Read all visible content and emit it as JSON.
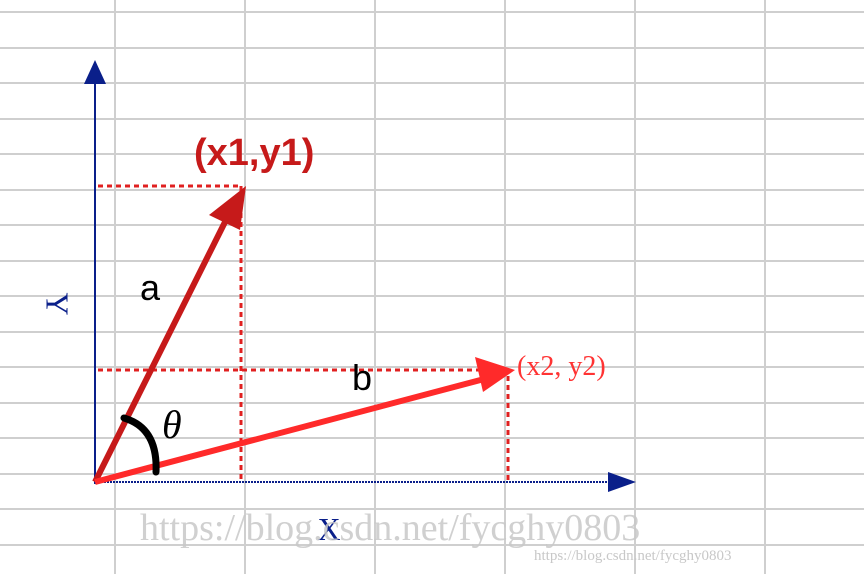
{
  "labels": {
    "y_axis": "Y",
    "x_axis": "X",
    "point1": "(x1,y1)",
    "point2": "(x2, y2)",
    "vector_a": "a",
    "vector_b": "b",
    "angle": "θ"
  },
  "watermark": {
    "large": "https://blog.csdn.net/fycghy0803",
    "small": "https://blog.csdn.net/fycghy0803"
  },
  "colors": {
    "grid": "#cfcfcf",
    "axis": "#0a1f8a",
    "vector_a": "#c61a1a",
    "vector_b": "#ff2a2a",
    "guide_lines": "#e02020",
    "label_point1": "#c61a1a",
    "label_point2": "#ff3333",
    "label_text": "#000000",
    "angle_arc": "#000000",
    "watermark": "#c8c8c8"
  }
}
